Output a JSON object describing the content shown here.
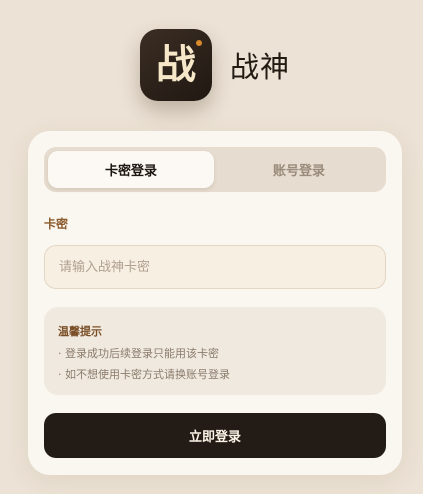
{
  "app": {
    "logo_char": "战",
    "name": "战神"
  },
  "tabs": [
    {
      "label": "卡密登录",
      "active": true
    },
    {
      "label": "账号登录",
      "active": false
    }
  ],
  "form": {
    "card_key_label": "卡密",
    "card_key_value": "",
    "card_key_placeholder": "请输入战神卡密"
  },
  "tips": {
    "title": "温馨提示",
    "lines": [
      "· 登录成功后续登录只能用该卡密",
      "· 如不想使用卡密方式请换账号登录"
    ]
  },
  "submit": {
    "label": "立即登录"
  },
  "colors": {
    "background": "#ece2d5",
    "card": "#faf6f0",
    "primary_button": "#231b16",
    "label_accent": "#8a5a2b",
    "logo_dot": "#d98a2a"
  }
}
